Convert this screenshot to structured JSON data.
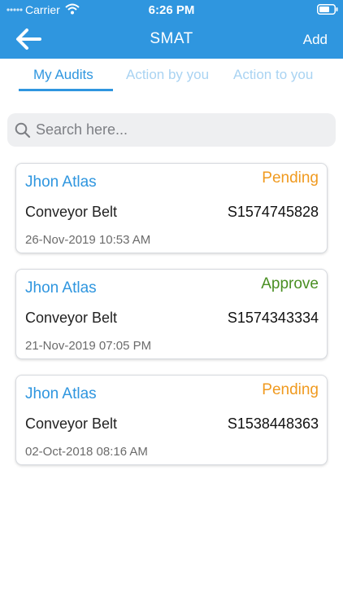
{
  "status_bar": {
    "carrier": "Carrier",
    "time": "6:26 PM"
  },
  "header": {
    "title": "SMAT",
    "add_label": "Add"
  },
  "tabs": [
    {
      "label": "My Audits",
      "active": true
    },
    {
      "label": "Action by you",
      "active": false
    },
    {
      "label": "Action to you",
      "active": false
    }
  ],
  "search": {
    "placeholder": "Search here...",
    "value": ""
  },
  "audits": [
    {
      "name": "Jhon Atlas",
      "status": "Pending",
      "equipment": "Conveyor Belt",
      "code": "S1574745828",
      "date": "26-Nov-2019 10:53 AM"
    },
    {
      "name": "Jhon Atlas",
      "status": "Approve",
      "equipment": "Conveyor Belt",
      "code": "S1574343334",
      "date": "21-Nov-2019 07:05 PM"
    },
    {
      "name": "Jhon Atlas",
      "status": "Pending",
      "equipment": "Conveyor Belt",
      "code": "S1538448363",
      "date": "02-Oct-2018 08:16 AM"
    }
  ],
  "colors": {
    "primary": "#2f96df",
    "pending": "#f09a1f",
    "approve": "#4a8f23"
  }
}
